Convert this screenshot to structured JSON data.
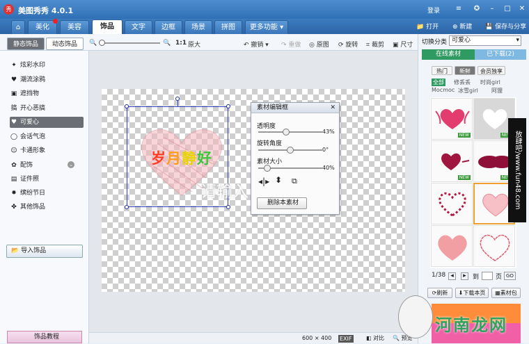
{
  "app": {
    "title": "美图秀秀 4.0.1",
    "login": "登录"
  },
  "tabs": [
    "美化",
    "美容",
    "饰品",
    "文字",
    "边框",
    "场景",
    "拼图",
    "更多功能"
  ],
  "top_actions": {
    "open": "打开",
    "new": "新建",
    "save": "保存与分享"
  },
  "toolbar": {
    "zoom_label": "1:1",
    "original_size": "原大",
    "undo": "撤销",
    "redo": "重做",
    "original": "原图",
    "rotate": "旋转",
    "crop": "裁剪",
    "size": "尺寸"
  },
  "subtabs": {
    "static": "静态饰品",
    "dynamic": "动态饰品"
  },
  "sidebar": {
    "items": [
      {
        "label": "炫彩水印",
        "icon": "✦"
      },
      {
        "label": "潮流涂鸦",
        "icon": "♥"
      },
      {
        "label": "遮挡物",
        "icon": "▣"
      },
      {
        "label": "开心恶搞",
        "icon": "搞"
      },
      {
        "label": "可爱心",
        "icon": "♥"
      },
      {
        "label": "会话气泡",
        "icon": "◯"
      },
      {
        "label": "卡通形象",
        "icon": "☺"
      },
      {
        "label": "配饰",
        "icon": "✿"
      },
      {
        "label": "证件照",
        "icon": "▤"
      },
      {
        "label": "缤纷节日",
        "icon": "✸"
      },
      {
        "label": "其他饰品",
        "icon": "✤"
      }
    ],
    "import_label": "导入饰品",
    "tutorial_label": "饰品教程"
  },
  "canvas": {
    "text_rainbow": "岁月静好",
    "text_white": "请输入"
  },
  "material_panel": {
    "title": "素材编辑框",
    "opacity_label": "透明度",
    "opacity_value": "43%",
    "opacity_level": 0.43,
    "rotation_label": "旋转角度",
    "rotation_value": "0°",
    "rotation_level": 0.5,
    "size_label": "素材大小",
    "size_value": "40%",
    "size_level": 0.1,
    "delete_label": "删除本素材"
  },
  "status": {
    "dimensions": "600 × 400",
    "exif": "EXIF",
    "compare": "对比",
    "preview": "预览"
  },
  "right": {
    "category_label": "切换分类",
    "category_value": "可爱心",
    "tab_online": "在线素材",
    "tab_downloaded": "已下载(2)",
    "chips": [
      "热门",
      "新鲜",
      "会员独享"
    ],
    "tags": [
      "全部",
      "修丢丢",
      "时尚girl",
      "Mocmoc",
      "冰雪girl",
      "阿狸"
    ],
    "page": "1/38",
    "goto": "到",
    "page_unit": "页",
    "go": "GO",
    "refresh": "刷新",
    "download_page": "下载本页",
    "material_pack": "素材包",
    "new_badge": "NEW"
  },
  "watermark": {
    "text": "放肆吧/www.fun48.com",
    "site": "河南龙网"
  }
}
